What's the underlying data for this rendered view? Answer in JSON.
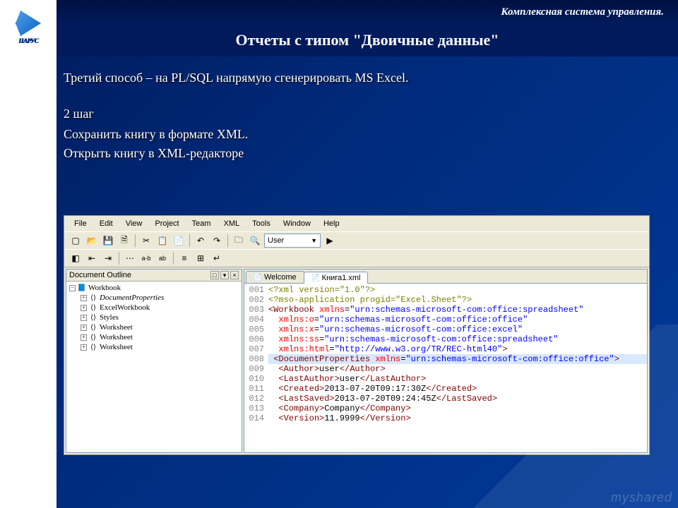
{
  "header": {
    "system_title": "Комплексная система управления.",
    "logo_text": "ПАРУС",
    "page_title": "Отчеты с типом \"Двоичные данные\""
  },
  "slide": {
    "intro": "Третий способ – на PL/SQL напрямую сгенерировать MS Excel.",
    "step": "2 шаг",
    "line1": "Сохранить книгу в формате XML.",
    "line2": "Открыть книгу в XML-редакторе"
  },
  "editor": {
    "menu": [
      "File",
      "Edit",
      "View",
      "Project",
      "Team",
      "XML",
      "Tools",
      "Window",
      "Help"
    ],
    "combo_value": "User",
    "outline_title": "Document Outline",
    "tree": {
      "root": "Workbook",
      "children": [
        "DocumentProperties",
        "ExcelWorkbook",
        "Styles",
        "Worksheet",
        "Worksheet",
        "Worksheet"
      ]
    },
    "tabs": [
      "Welcome",
      "Книга1.xml"
    ],
    "active_tab": 1,
    "code_lines": [
      {
        "n": "001",
        "type": "decl",
        "text": "<?xml version=\"1.0\"?>"
      },
      {
        "n": "002",
        "type": "decl",
        "text": "<?mso-application progid=\"Excel.Sheet\"?>"
      },
      {
        "n": "003",
        "type": "open",
        "tag": "Workbook",
        "attrs": [
          [
            "xmlns",
            "urn:schemas-microsoft-com:office:spreadsheet"
          ]
        ]
      },
      {
        "n": "004",
        "type": "attrline",
        "attrs": [
          [
            "xmlns:o",
            "urn:schemas-microsoft-com:office:office"
          ]
        ]
      },
      {
        "n": "005",
        "type": "attrline",
        "attrs": [
          [
            "xmlns:x",
            "urn:schemas-microsoft-com:office:excel"
          ]
        ]
      },
      {
        "n": "006",
        "type": "attrline",
        "attrs": [
          [
            "xmlns:ss",
            "urn:schemas-microsoft-com:office:spreadsheet"
          ]
        ]
      },
      {
        "n": "007",
        "type": "attrclose",
        "attrs": [
          [
            "xmlns:html",
            "http://www.w3.org/TR/REC-html40"
          ]
        ]
      },
      {
        "n": "008",
        "type": "sel",
        "tag": "DocumentProperties",
        "attrs": [
          [
            "xmlns",
            "urn:schemas-microsoft-com:office:office"
          ]
        ]
      },
      {
        "n": "009",
        "type": "elem",
        "tag": "Author",
        "text": "user"
      },
      {
        "n": "010",
        "type": "elem",
        "tag": "LastAuthor",
        "text": "user"
      },
      {
        "n": "011",
        "type": "elem",
        "tag": "Created",
        "text": "2013-07-20T09:17:30Z"
      },
      {
        "n": "012",
        "type": "elem",
        "tag": "LastSaved",
        "text": "2013-07-20T09:24:45Z"
      },
      {
        "n": "013",
        "type": "elem",
        "tag": "Company",
        "text": "Company"
      },
      {
        "n": "014",
        "type": "elem",
        "tag": "Version",
        "text": "11.9999"
      }
    ]
  },
  "watermark": "myshared"
}
